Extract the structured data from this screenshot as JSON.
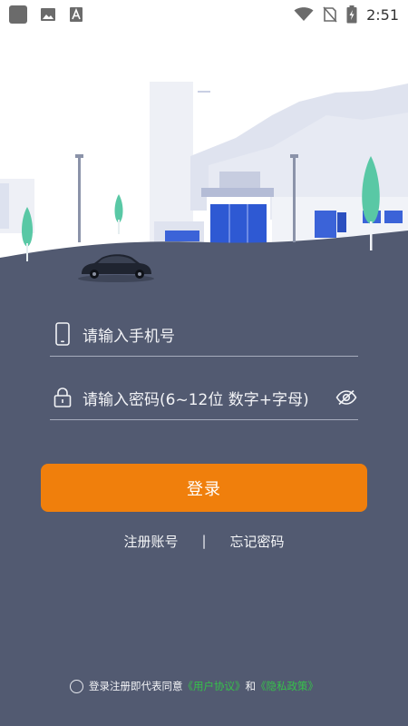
{
  "status_bar": {
    "time": "2:51",
    "icons": [
      "app-square-icon",
      "image-icon",
      "font-icon",
      "wifi-icon",
      "no-sim-icon",
      "battery-charging-icon"
    ]
  },
  "login": {
    "phone_placeholder": "请输入手机号",
    "password_placeholder": "请输入密码(6~12位 数字+字母)",
    "submit_label": "登录"
  },
  "links": {
    "register": "注册账号",
    "separator": "|",
    "forgot": "忘记密码"
  },
  "agreement": {
    "prefix": "登录注册即代表同意",
    "user_agreement": "《用户协议》",
    "and": "和",
    "privacy_policy": "《隐私政策》"
  },
  "colors": {
    "panel": "#525a71",
    "accent": "#f07f0c",
    "link_green": "#36c24a"
  }
}
